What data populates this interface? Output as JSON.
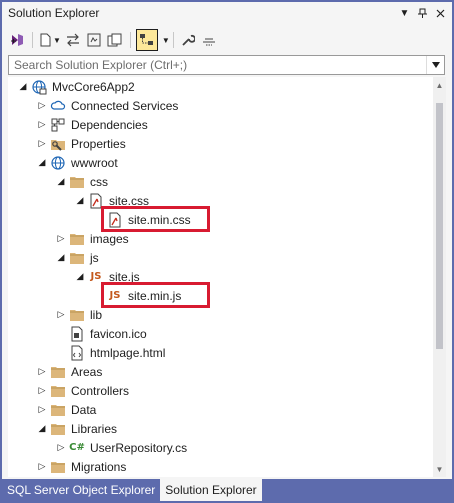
{
  "window": {
    "title": "Solution Explorer"
  },
  "search": {
    "placeholder": "Search Solution Explorer (Ctrl+;)"
  },
  "tree": {
    "project": "MvcCore6App2",
    "connected_services": "Connected Services",
    "dependencies": "Dependencies",
    "properties": "Properties",
    "wwwroot": "wwwroot",
    "css": "css",
    "site_css": "site.css",
    "site_min_css": "site.min.css",
    "images": "images",
    "js": "js",
    "site_js": "site.js",
    "site_min_js": "site.min.js",
    "lib": "lib",
    "favicon": "favicon.ico",
    "htmlpage": "htmlpage.html",
    "areas": "Areas",
    "controllers": "Controllers",
    "data": "Data",
    "libraries": "Libraries",
    "user_repository": "UserRepository.cs",
    "migrations": "Migrations"
  },
  "tabs": {
    "sql_server": "SQL Server Object Explorer",
    "solution_explorer": "Solution Explorer"
  },
  "icons": {
    "csharp_glyph": "C#",
    "js_glyph": "JS"
  },
  "colors": {
    "frame_accent": "#5d6bad",
    "highlight_box": "#d81b31",
    "folder_yellow": "#dcb67a",
    "active_tool": "#fde89a"
  }
}
